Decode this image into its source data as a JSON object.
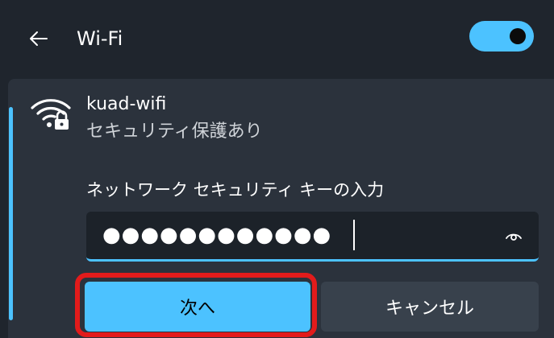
{
  "header": {
    "title": "Wi-Fi",
    "back_icon": "arrow-left-icon",
    "toggle_on": true
  },
  "network": {
    "name": "kuad-wifi",
    "status": "セキュリティ保護あり",
    "icon": "wifi-secured-icon"
  },
  "security_key": {
    "label": "ネットワーク セキュリティ キーの入力",
    "masked_value": "●●●●●●●●●●●●",
    "reveal_icon": "eye-icon"
  },
  "buttons": {
    "next_label": "次へ",
    "cancel_label": "キャンセル"
  },
  "colors": {
    "accent": "#4cc2ff",
    "highlight": "#e21b1b",
    "background": "#1f252d",
    "panel": "#2b323c"
  }
}
